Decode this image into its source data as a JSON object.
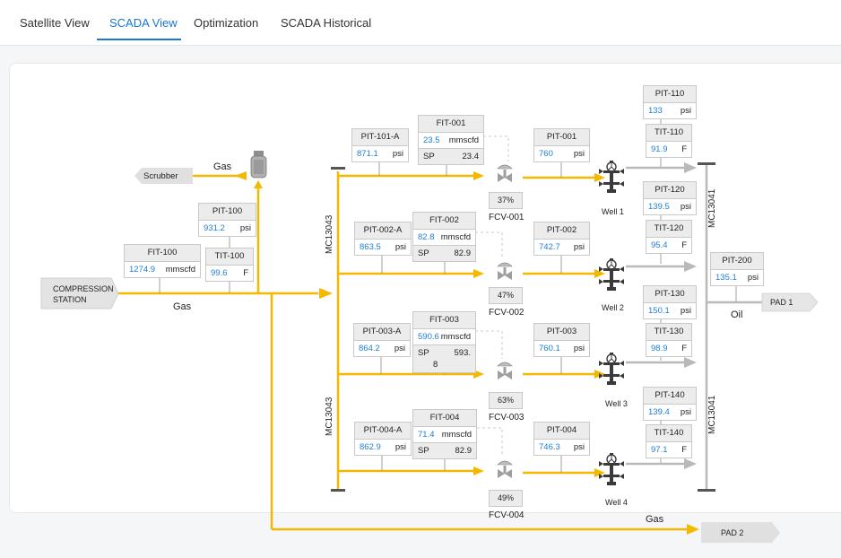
{
  "tabs": [
    {
      "label": "Satellite View"
    },
    {
      "label": "SCADA View"
    },
    {
      "label": "Optimization"
    },
    {
      "label": "SCADA Historical"
    }
  ],
  "active_tab": "SCADA View",
  "colors": {
    "gas_line": "#f5b800",
    "oil_line": "#b9b9b9",
    "accent": "#1976d2",
    "value": "#1e7fd6"
  },
  "labels": {
    "compression": "COMPRESSION STATION",
    "scrubber": "Scrubber",
    "gas_top": "Gas",
    "gas_mid": "Gas",
    "gas_bottom": "Gas",
    "oil": "Oil",
    "pad1": "PAD 1",
    "pad2": "PAD 2",
    "mc_left_top": "MC13043",
    "mc_left_bottom": "MC13043",
    "mc_right_top": "MC13041",
    "mc_right_bottom": "MC13041"
  },
  "instruments": {
    "fit100": {
      "tag": "FIT-100",
      "value": "1274.9",
      "unit": "mmscfd"
    },
    "pit100": {
      "tag": "PIT-100",
      "value": "931.2",
      "unit": "psi"
    },
    "tit100": {
      "tag": "TIT-100",
      "value": "99.6",
      "unit": "F"
    },
    "pit101a": {
      "tag": "PIT-101-A",
      "value": "871.1",
      "unit": "psi"
    },
    "pit002a": {
      "tag": "PIT-002-A",
      "value": "863.5",
      "unit": "psi"
    },
    "pit003a": {
      "tag": "PIT-003-A",
      "value": "864.2",
      "unit": "psi"
    },
    "pit004a": {
      "tag": "PIT-004-A",
      "value": "862.9",
      "unit": "psi"
    },
    "fit001": {
      "tag": "FIT-001",
      "value": "23.5",
      "unit": "mmscfd",
      "sp_label": "SP",
      "sp": "23.4"
    },
    "fit002": {
      "tag": "FIT-002",
      "value": "82.8",
      "unit": "mmscfd",
      "sp_label": "SP",
      "sp": "82.9"
    },
    "fit003": {
      "tag": "FIT-003",
      "value": "590.6",
      "unit": "mmscfd",
      "sp_label": "SP",
      "sp": "593.",
      "sp2": "8"
    },
    "fit004": {
      "tag": "FIT-004",
      "value": "71.4",
      "unit": "mmscfd",
      "sp_label": "SP",
      "sp": "82.9"
    },
    "pit001": {
      "tag": "PIT-001",
      "value": "760",
      "unit": "psi"
    },
    "pit002": {
      "tag": "PIT-002",
      "value": "742.7",
      "unit": "psi"
    },
    "pit003": {
      "tag": "PIT-003",
      "value": "760.1",
      "unit": "psi"
    },
    "pit004": {
      "tag": "PIT-004",
      "value": "746.3",
      "unit": "psi"
    },
    "pit110": {
      "tag": "PIT-110",
      "value": "133",
      "unit": "psi"
    },
    "tit110": {
      "tag": "TIT-110",
      "value": "91.9",
      "unit": "F"
    },
    "pit120": {
      "tag": "PIT-120",
      "value": "139.5",
      "unit": "psi"
    },
    "tit120": {
      "tag": "TIT-120",
      "value": "95.4",
      "unit": "F"
    },
    "pit130": {
      "tag": "PIT-130",
      "value": "150.1",
      "unit": "psi"
    },
    "tit130": {
      "tag": "TIT-130",
      "value": "98.9",
      "unit": "F"
    },
    "pit140": {
      "tag": "PIT-140",
      "value": "139.4",
      "unit": "psi"
    },
    "tit140": {
      "tag": "TIT-140",
      "value": "97.1",
      "unit": "F"
    },
    "pit200": {
      "tag": "PIT-200",
      "value": "135.1",
      "unit": "psi"
    }
  },
  "valves": [
    {
      "pct": "37%",
      "name": "FCV-001"
    },
    {
      "pct": "47%",
      "name": "FCV-002"
    },
    {
      "pct": "63%",
      "name": "FCV-003"
    },
    {
      "pct": "49%",
      "name": "FCV-004"
    }
  ],
  "wells": [
    {
      "name": "Well 1"
    },
    {
      "name": "Well 2"
    },
    {
      "name": "Well 3"
    },
    {
      "name": "Well 4"
    }
  ]
}
